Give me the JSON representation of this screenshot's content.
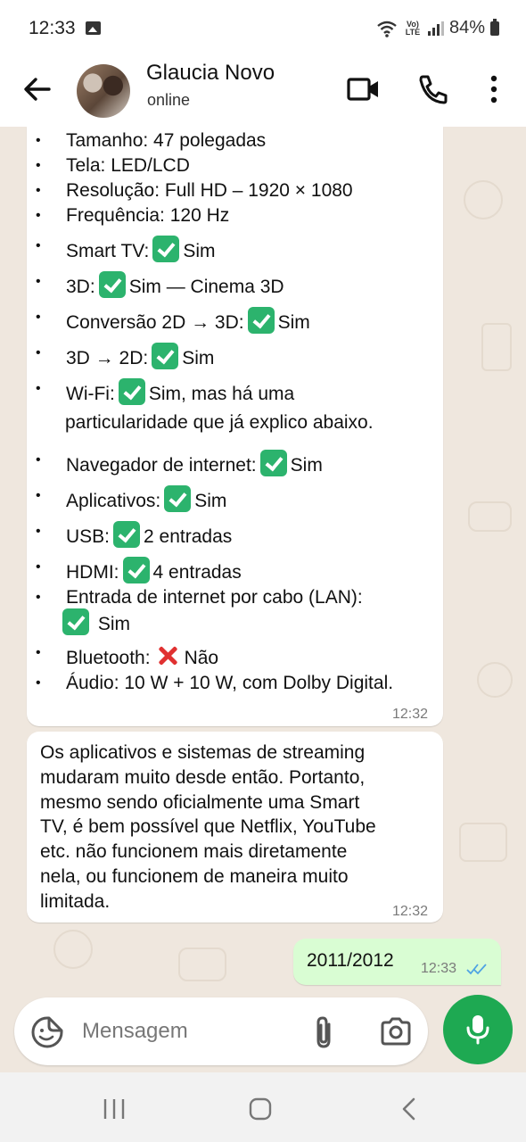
{
  "status_bar": {
    "time": "12:33",
    "volte": "Vo) LTE",
    "battery": "84%"
  },
  "header": {
    "contact_name": "Glaucia Novo",
    "status": "online"
  },
  "chat": {
    "spec_items": [
      {
        "label": "Tamanho: 47 polegadas",
        "icon": null,
        "suffix": ""
      },
      {
        "label": "Tela: LED/LCD",
        "icon": null,
        "suffix": ""
      },
      {
        "label": "Resolução: Full HD – 1920 × 1080",
        "icon": null,
        "suffix": ""
      },
      {
        "label": "Frequência: 120 Hz",
        "icon": null,
        "suffix": ""
      },
      {
        "label": "Smart TV:",
        "icon": "check-icon",
        "suffix": "Sim"
      },
      {
        "label": "3D:",
        "icon": "check-icon",
        "suffix": "Sim — Cinema 3D"
      },
      {
        "label": "Conversão 2D → 3D:",
        "icon": "check-icon",
        "suffix": "Sim"
      },
      {
        "label": "3D → 2D:",
        "icon": "check-icon",
        "suffix": "Sim"
      },
      {
        "label": "Wi-Fi:",
        "icon": "check-icon",
        "suffix": "Sim, mas há uma"
      },
      {
        "label": "Navegador de internet:",
        "icon": "check-icon",
        "suffix": "Sim"
      },
      {
        "label": "Aplicativos:",
        "icon": "check-icon",
        "suffix": "Sim"
      },
      {
        "label": "USB:",
        "icon": "check-icon",
        "suffix": "2 entradas"
      },
      {
        "label": "HDMI:",
        "icon": "check-icon",
        "suffix": "4 entradas"
      },
      {
        "label": "Entrada de internet por cabo (LAN):",
        "icon": null,
        "suffix": ""
      },
      {
        "label": "Bluetooth:",
        "icon": "cross-icon",
        "suffix": "Não"
      },
      {
        "label": "Áudio: 10 W + 10 W, com Dolby Digital.",
        "icon": null,
        "suffix": ""
      }
    ],
    "wifi_continuation": "particularidade que já explico abaixo.",
    "lan_continuation": "Sim",
    "msg1_time": "12:32",
    "msg2_lines": [
      "Os aplicativos e sistemas de streaming",
      "mudaram muito desde então. Portanto,",
      "mesmo sendo oficialmente uma Smart",
      "TV, é bem possível que Netflix, YouTube",
      "etc. não funcionem mais diretamente",
      "nela, ou funcionem de maneira muito",
      "limitada."
    ],
    "msg2_time": "12:32",
    "msg3_text": "2011/2012",
    "msg3_time": "12:33"
  },
  "input_bar": {
    "placeholder": "Mensagem"
  },
  "colors": {
    "check": "#2cb36d",
    "cross": "#e03131",
    "mic": "#1ea952",
    "outgoing": "#d9fdd3",
    "ticks": "#4fa3e3"
  }
}
